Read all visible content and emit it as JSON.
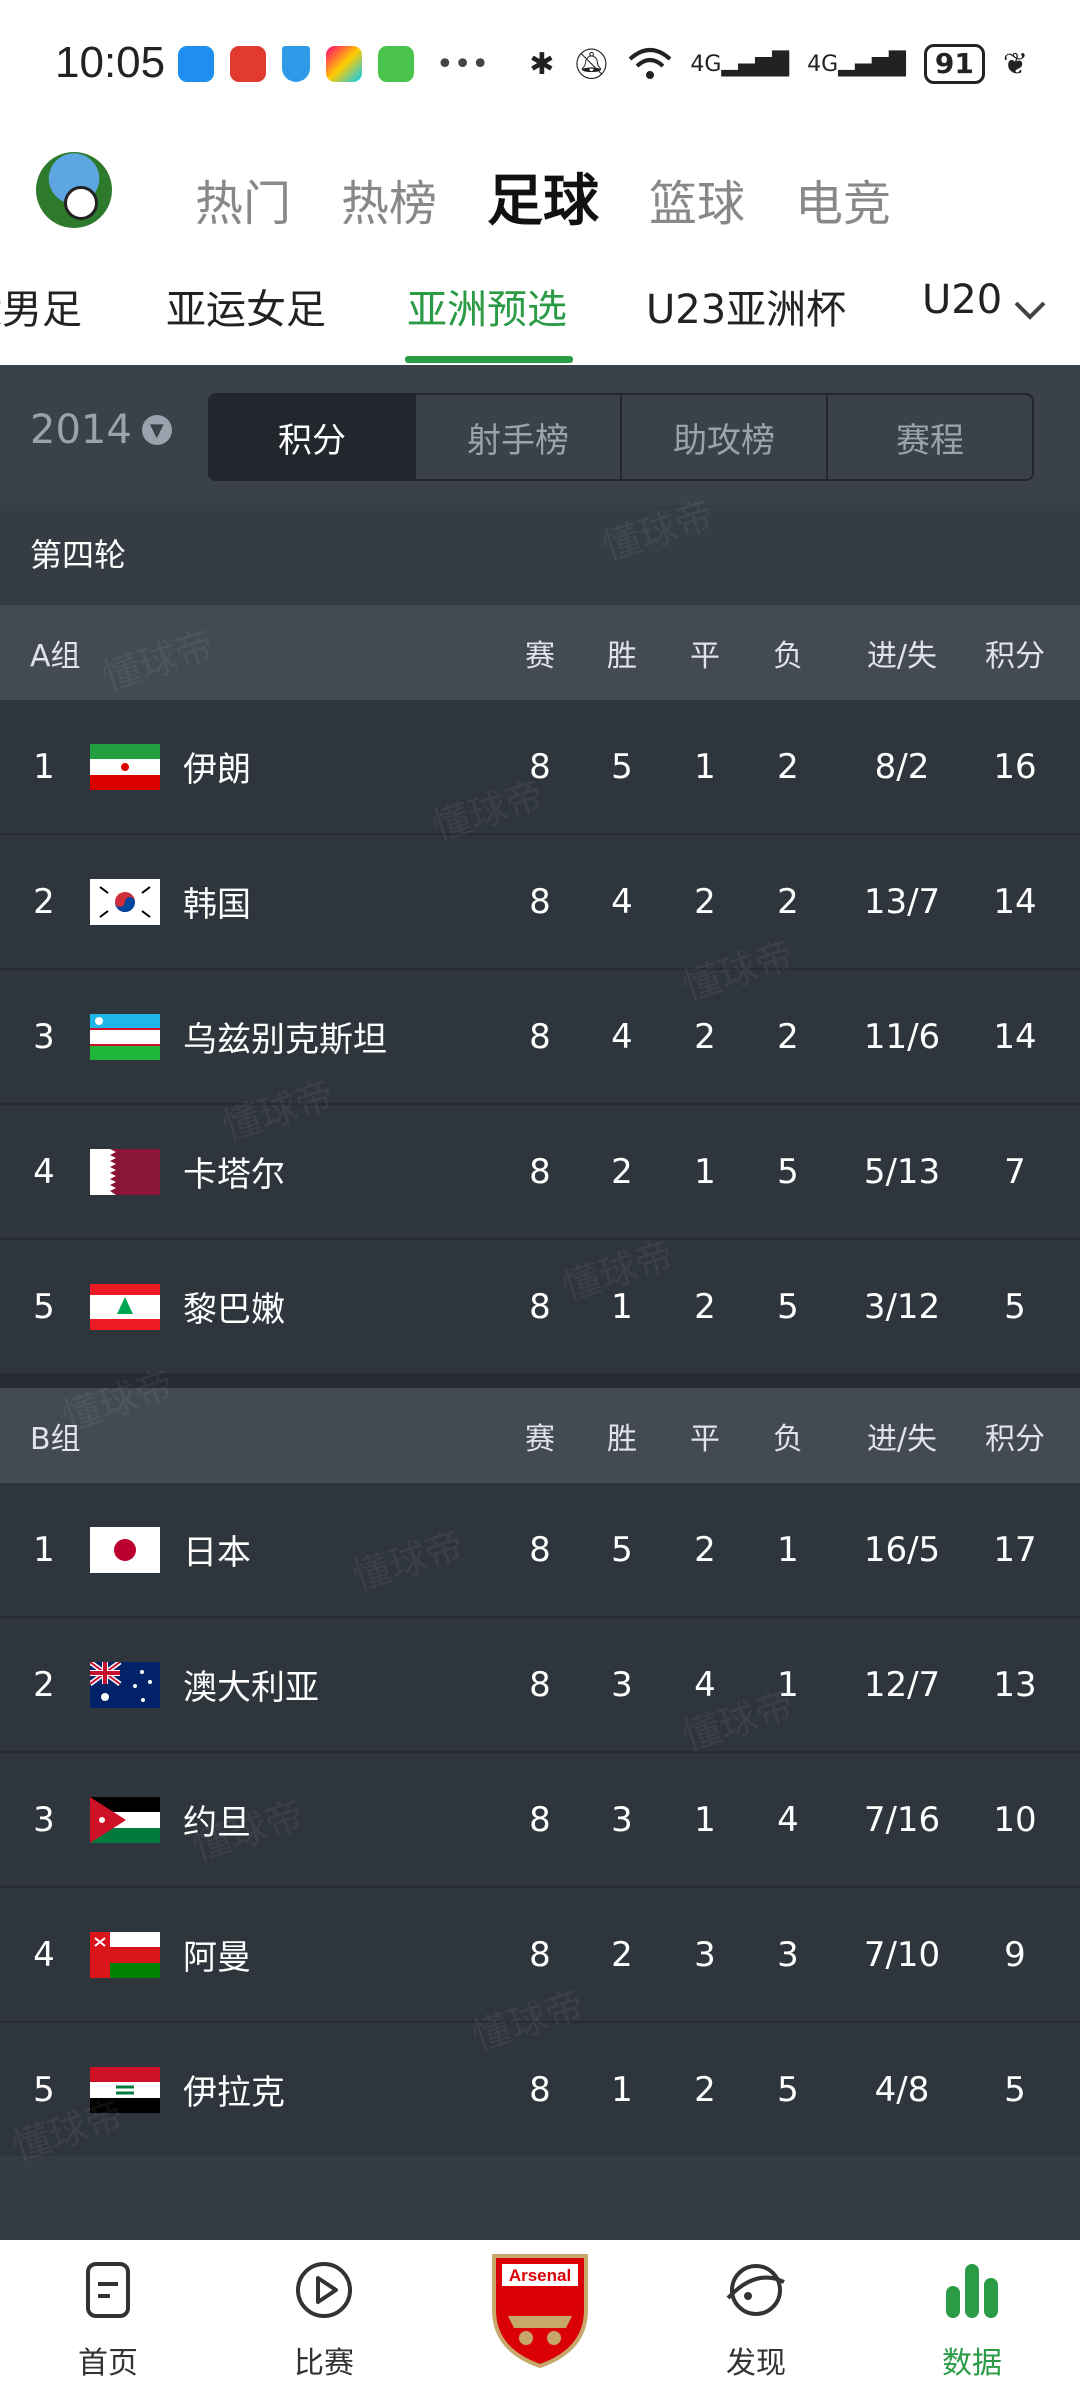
{
  "status_bar": {
    "time": "10:05",
    "network": "4G",
    "battery": "91"
  },
  "main_tabs": [
    {
      "label": "热门",
      "active": false
    },
    {
      "label": "热榜",
      "active": false
    },
    {
      "label": "足球",
      "active": true
    },
    {
      "label": "篮球",
      "active": false
    },
    {
      "label": "电竞",
      "active": false
    }
  ],
  "sub_tabs": [
    {
      "label": "亚运男足",
      "active": false
    },
    {
      "label": "亚运女足",
      "active": false
    },
    {
      "label": "亚洲预选",
      "active": true
    },
    {
      "label": "U23亚洲杯",
      "active": false
    },
    {
      "label": "U20",
      "active": false
    }
  ],
  "filter": {
    "year": "2014",
    "segments": [
      "积分",
      "射手榜",
      "助攻榜",
      "赛程"
    ],
    "active_index": 0
  },
  "round": "第四轮",
  "columns": {
    "played": "赛",
    "won": "胜",
    "drawn": "平",
    "lost": "负",
    "goals": "进/失",
    "points": "积分"
  },
  "groups": [
    {
      "name": "A组",
      "rows": [
        {
          "rank": "1",
          "team": "伊朗",
          "flag": "iran-flag",
          "p": "8",
          "w": "5",
          "d": "1",
          "l": "2",
          "g": "8/2",
          "pts": "16"
        },
        {
          "rank": "2",
          "team": "韩国",
          "flag": "korea-flag",
          "p": "8",
          "w": "4",
          "d": "2",
          "l": "2",
          "g": "13/7",
          "pts": "14"
        },
        {
          "rank": "3",
          "team": "乌兹别克斯坦",
          "flag": "uzbekistan-flag",
          "p": "8",
          "w": "4",
          "d": "2",
          "l": "2",
          "g": "11/6",
          "pts": "14"
        },
        {
          "rank": "4",
          "team": "卡塔尔",
          "flag": "qatar-flag",
          "p": "8",
          "w": "2",
          "d": "1",
          "l": "5",
          "g": "5/13",
          "pts": "7"
        },
        {
          "rank": "5",
          "team": "黎巴嫩",
          "flag": "lebanon-flag",
          "p": "8",
          "w": "1",
          "d": "2",
          "l": "5",
          "g": "3/12",
          "pts": "5"
        }
      ]
    },
    {
      "name": "B组",
      "rows": [
        {
          "rank": "1",
          "team": "日本",
          "flag": "japan-flag",
          "p": "8",
          "w": "5",
          "d": "2",
          "l": "1",
          "g": "16/5",
          "pts": "17"
        },
        {
          "rank": "2",
          "team": "澳大利亚",
          "flag": "australia-flag",
          "p": "8",
          "w": "3",
          "d": "4",
          "l": "1",
          "g": "12/7",
          "pts": "13"
        },
        {
          "rank": "3",
          "team": "约旦",
          "flag": "jordan-flag",
          "p": "8",
          "w": "3",
          "d": "1",
          "l": "4",
          "g": "7/16",
          "pts": "10"
        },
        {
          "rank": "4",
          "team": "阿曼",
          "flag": "oman-flag",
          "p": "8",
          "w": "2",
          "d": "3",
          "l": "3",
          "g": "7/10",
          "pts": "9"
        },
        {
          "rank": "5",
          "team": "伊拉克",
          "flag": "iraq-flag",
          "p": "8",
          "w": "1",
          "d": "2",
          "l": "5",
          "g": "4/8",
          "pts": "5"
        }
      ]
    }
  ],
  "watermark": "懂球帝",
  "crest_text": "Arsenal",
  "bottom_nav": [
    {
      "label": "首页",
      "icon": "home-icon",
      "active": false
    },
    {
      "label": "比赛",
      "icon": "play-icon",
      "active": false
    },
    {
      "label": "发现",
      "icon": "discover-icon",
      "active": false
    },
    {
      "label": "数据",
      "icon": "data-bars-icon",
      "active": true
    }
  ],
  "colors": {
    "accent": "#2b9b45",
    "bg": "#2f353d",
    "header": "#434a53"
  }
}
